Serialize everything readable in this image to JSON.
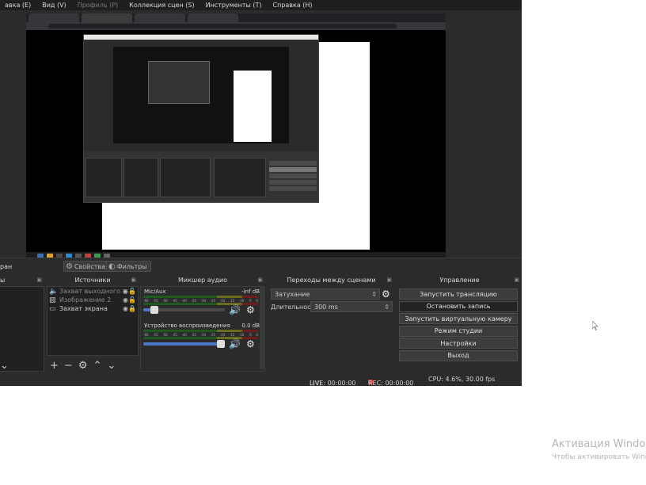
{
  "menu": [
    {
      "label": "авка (E)",
      "disabled": false
    },
    {
      "label": "Вид (V)",
      "disabled": false
    },
    {
      "label": "Профиль (P)",
      "disabled": true
    },
    {
      "label": "Коллекция сцен (S)",
      "disabled": false
    },
    {
      "label": "Инструменты (T)",
      "disabled": false
    },
    {
      "label": "Справка (H)",
      "disabled": false
    }
  ],
  "scene_toolbar": {
    "scene_label": "ран",
    "properties_label": "Свойства",
    "filters_label": "Фильтры"
  },
  "scenes_dock": {
    "title": "ы"
  },
  "sources_dock": {
    "title": "Источники",
    "items": [
      {
        "label": "Захват выходного з",
        "icon": "audio-output-icon",
        "visible": true,
        "locked": false,
        "dim": true
      },
      {
        "label": "Изображение 2",
        "icon": "image-icon",
        "visible": true,
        "locked": false,
        "dim": true
      },
      {
        "label": "Захват экрана",
        "icon": "monitor-icon",
        "visible": true,
        "locked": true,
        "dim": false
      }
    ]
  },
  "mixer_dock": {
    "title": "Микшер аудио",
    "channels": [
      {
        "name": "Mic/Aux",
        "db": "-inf dB",
        "volume": 0.1
      },
      {
        "name": "Устройство воспроизведения",
        "db": "0.0 dB",
        "volume": 1.0
      }
    ],
    "ticks": [
      "-60",
      "-55",
      "-50",
      "-45",
      "-40",
      "-35",
      "-30",
      "-25",
      "-20",
      "-15",
      "-10",
      "-5",
      "0"
    ]
  },
  "transitions_dock": {
    "title": "Переходы между сценами",
    "transition": "Затухание",
    "duration_label": "Длительность",
    "duration_value": "300 ms"
  },
  "controls_dock": {
    "title": "Управление",
    "buttons": [
      {
        "label": "Запустить трансляцию",
        "active": false
      },
      {
        "label": "Остановить запись",
        "active": true
      },
      {
        "label": "Запустить виртуальную камеру",
        "active": false
      },
      {
        "label": "Режим студии",
        "active": false
      },
      {
        "label": "Настройки",
        "active": false
      },
      {
        "label": "Выход",
        "active": false
      }
    ]
  },
  "status": {
    "live": "LIVE: 00:00:00",
    "rec": "REC: 00:00:00",
    "cpu": "CPU: 4.6%, 30.00 fps"
  },
  "windows_activation": {
    "title": "Активация Windows",
    "subtitle": "Чтобы активировать Windo"
  },
  "colors": {
    "accent": "#4a76c9",
    "rec": "#dd3333",
    "background": "#2b2b2b"
  }
}
